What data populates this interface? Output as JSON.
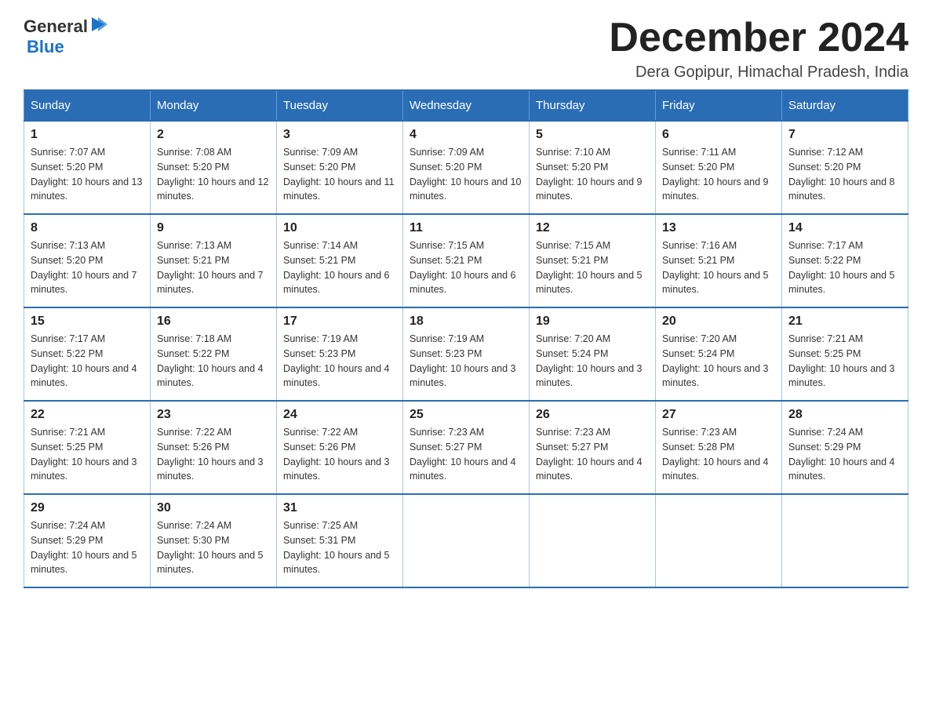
{
  "header": {
    "logo_general": "General",
    "logo_blue": "Blue",
    "month_title": "December 2024",
    "location": "Dera Gopipur, Himachal Pradesh, India"
  },
  "days_of_week": [
    "Sunday",
    "Monday",
    "Tuesday",
    "Wednesday",
    "Thursday",
    "Friday",
    "Saturday"
  ],
  "weeks": [
    [
      {
        "day": "1",
        "sunrise": "7:07 AM",
        "sunset": "5:20 PM",
        "daylight": "10 hours and 13 minutes."
      },
      {
        "day": "2",
        "sunrise": "7:08 AM",
        "sunset": "5:20 PM",
        "daylight": "10 hours and 12 minutes."
      },
      {
        "day": "3",
        "sunrise": "7:09 AM",
        "sunset": "5:20 PM",
        "daylight": "10 hours and 11 minutes."
      },
      {
        "day": "4",
        "sunrise": "7:09 AM",
        "sunset": "5:20 PM",
        "daylight": "10 hours and 10 minutes."
      },
      {
        "day": "5",
        "sunrise": "7:10 AM",
        "sunset": "5:20 PM",
        "daylight": "10 hours and 9 minutes."
      },
      {
        "day": "6",
        "sunrise": "7:11 AM",
        "sunset": "5:20 PM",
        "daylight": "10 hours and 9 minutes."
      },
      {
        "day": "7",
        "sunrise": "7:12 AM",
        "sunset": "5:20 PM",
        "daylight": "10 hours and 8 minutes."
      }
    ],
    [
      {
        "day": "8",
        "sunrise": "7:13 AM",
        "sunset": "5:20 PM",
        "daylight": "10 hours and 7 minutes."
      },
      {
        "day": "9",
        "sunrise": "7:13 AM",
        "sunset": "5:21 PM",
        "daylight": "10 hours and 7 minutes."
      },
      {
        "day": "10",
        "sunrise": "7:14 AM",
        "sunset": "5:21 PM",
        "daylight": "10 hours and 6 minutes."
      },
      {
        "day": "11",
        "sunrise": "7:15 AM",
        "sunset": "5:21 PM",
        "daylight": "10 hours and 6 minutes."
      },
      {
        "day": "12",
        "sunrise": "7:15 AM",
        "sunset": "5:21 PM",
        "daylight": "10 hours and 5 minutes."
      },
      {
        "day": "13",
        "sunrise": "7:16 AM",
        "sunset": "5:21 PM",
        "daylight": "10 hours and 5 minutes."
      },
      {
        "day": "14",
        "sunrise": "7:17 AM",
        "sunset": "5:22 PM",
        "daylight": "10 hours and 5 minutes."
      }
    ],
    [
      {
        "day": "15",
        "sunrise": "7:17 AM",
        "sunset": "5:22 PM",
        "daylight": "10 hours and 4 minutes."
      },
      {
        "day": "16",
        "sunrise": "7:18 AM",
        "sunset": "5:22 PM",
        "daylight": "10 hours and 4 minutes."
      },
      {
        "day": "17",
        "sunrise": "7:19 AM",
        "sunset": "5:23 PM",
        "daylight": "10 hours and 4 minutes."
      },
      {
        "day": "18",
        "sunrise": "7:19 AM",
        "sunset": "5:23 PM",
        "daylight": "10 hours and 3 minutes."
      },
      {
        "day": "19",
        "sunrise": "7:20 AM",
        "sunset": "5:24 PM",
        "daylight": "10 hours and 3 minutes."
      },
      {
        "day": "20",
        "sunrise": "7:20 AM",
        "sunset": "5:24 PM",
        "daylight": "10 hours and 3 minutes."
      },
      {
        "day": "21",
        "sunrise": "7:21 AM",
        "sunset": "5:25 PM",
        "daylight": "10 hours and 3 minutes."
      }
    ],
    [
      {
        "day": "22",
        "sunrise": "7:21 AM",
        "sunset": "5:25 PM",
        "daylight": "10 hours and 3 minutes."
      },
      {
        "day": "23",
        "sunrise": "7:22 AM",
        "sunset": "5:26 PM",
        "daylight": "10 hours and 3 minutes."
      },
      {
        "day": "24",
        "sunrise": "7:22 AM",
        "sunset": "5:26 PM",
        "daylight": "10 hours and 3 minutes."
      },
      {
        "day": "25",
        "sunrise": "7:23 AM",
        "sunset": "5:27 PM",
        "daylight": "10 hours and 4 minutes."
      },
      {
        "day": "26",
        "sunrise": "7:23 AM",
        "sunset": "5:27 PM",
        "daylight": "10 hours and 4 minutes."
      },
      {
        "day": "27",
        "sunrise": "7:23 AM",
        "sunset": "5:28 PM",
        "daylight": "10 hours and 4 minutes."
      },
      {
        "day": "28",
        "sunrise": "7:24 AM",
        "sunset": "5:29 PM",
        "daylight": "10 hours and 4 minutes."
      }
    ],
    [
      {
        "day": "29",
        "sunrise": "7:24 AM",
        "sunset": "5:29 PM",
        "daylight": "10 hours and 5 minutes."
      },
      {
        "day": "30",
        "sunrise": "7:24 AM",
        "sunset": "5:30 PM",
        "daylight": "10 hours and 5 minutes."
      },
      {
        "day": "31",
        "sunrise": "7:25 AM",
        "sunset": "5:31 PM",
        "daylight": "10 hours and 5 minutes."
      },
      null,
      null,
      null,
      null
    ]
  ],
  "labels": {
    "sunrise_prefix": "Sunrise: ",
    "sunset_prefix": "Sunset: ",
    "daylight_prefix": "Daylight: "
  }
}
